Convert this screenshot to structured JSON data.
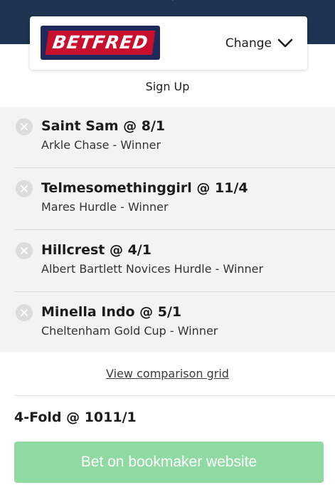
{
  "header": {
    "brand_colors": {
      "band": "#1f3352",
      "accent": "#f3c517"
    }
  },
  "bookmaker": {
    "logo_text": "BETFRED",
    "change_label": "Change"
  },
  "signup_label": "Sign Up",
  "selections": [
    {
      "title": "Saint Sam @ 8/1",
      "market": "Arkle Chase - Winner"
    },
    {
      "title": "Telmesomethinggirl @ 11/4",
      "market": "Mares Hurdle - Winner"
    },
    {
      "title": "Hillcrest @ 4/1",
      "market": "Albert Bartlett Novices Hurdle - Winner"
    },
    {
      "title": "Minella Indo @ 5/1",
      "market": "Cheltenham Gold Cup - Winner"
    }
  ],
  "comparison_link": "View comparison grid",
  "acca_summary": "4-Fold @ 1011/1",
  "bet_button_label": "Bet on bookmaker website",
  "colors": {
    "bet_button": "#8fdaa3",
    "selections_bg": "#f3f3f3"
  }
}
